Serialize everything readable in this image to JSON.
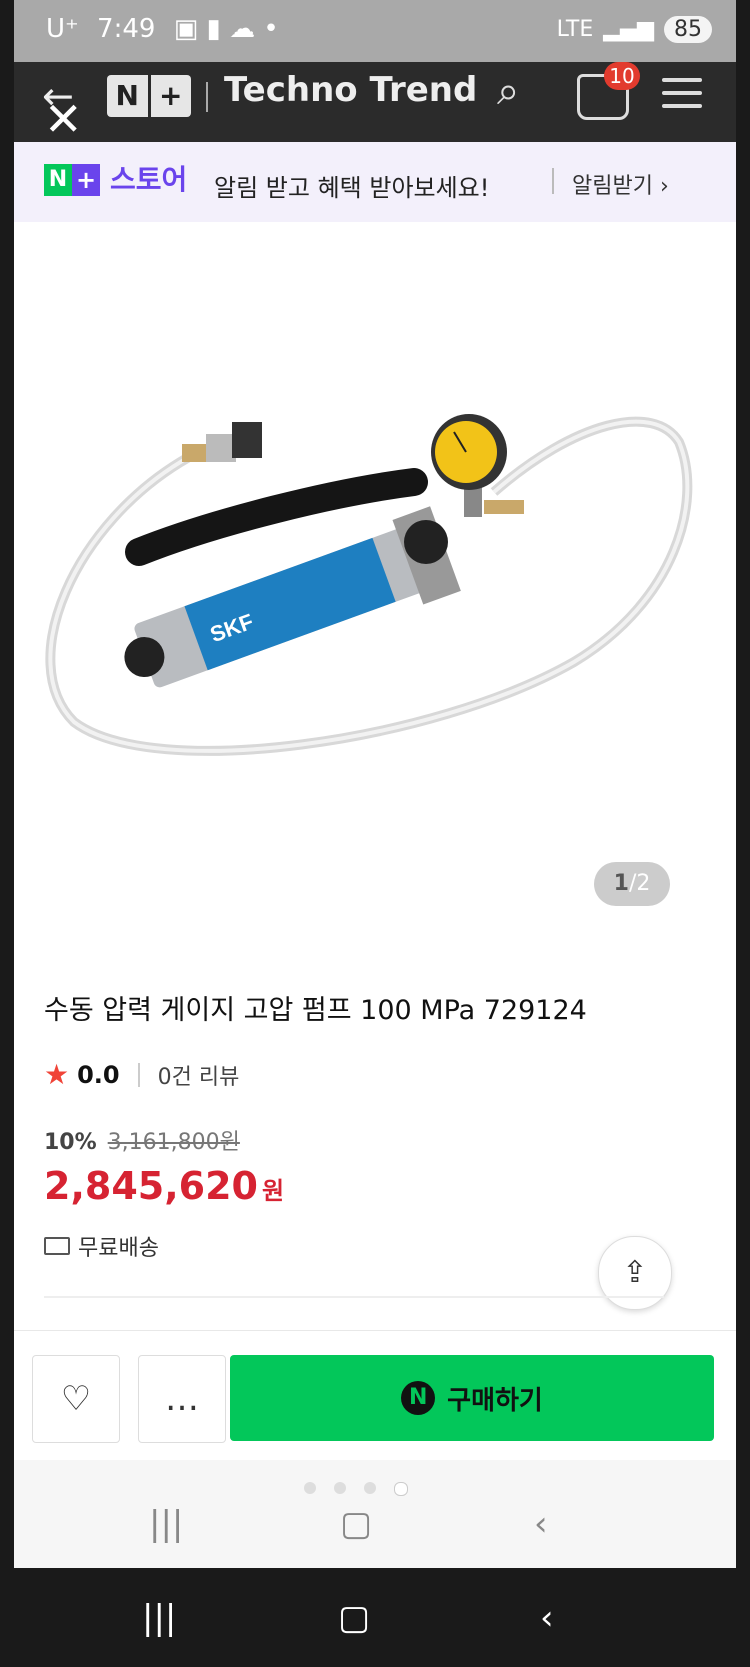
{
  "status_bar": {
    "carrier": "U⁺",
    "time": "7:49",
    "network": "LTE",
    "battery": "85"
  },
  "header": {
    "logo_n": "N",
    "logo_plus": "+",
    "store_name": "Techno Trend",
    "cart_badge": "10"
  },
  "notice": {
    "logo_n": "N",
    "logo_plus": "+",
    "logo_store": "스토어",
    "message": "알림 받고 혜택 받아보세요!",
    "action": "알림받기 ›"
  },
  "gallery": {
    "current": "1",
    "separator": "/",
    "total": "2",
    "brand_label": "SKF"
  },
  "product": {
    "title": "수동 압력 게이지 고압 펌프 100 MPa 729124",
    "rating_score": "0.0",
    "review_count": "0건 리뷰",
    "discount": "10%",
    "original_price": "3,161,800원",
    "price": "2,845,620",
    "price_unit": "원",
    "shipping": "무료배송"
  },
  "actions": {
    "buy_icon": "N",
    "buy_label": "구매하기"
  },
  "colors": {
    "naver_green": "#03c75a",
    "store_purple": "#6a44ec",
    "price_red": "#d62332",
    "header_bg": "#2b2b2b"
  },
  "icons": [
    "back-arrow-icon",
    "close-icon",
    "search-icon",
    "cart-icon",
    "menu-icon",
    "star-icon",
    "truck-icon",
    "share-icon",
    "heart-icon",
    "chat-icon"
  ]
}
